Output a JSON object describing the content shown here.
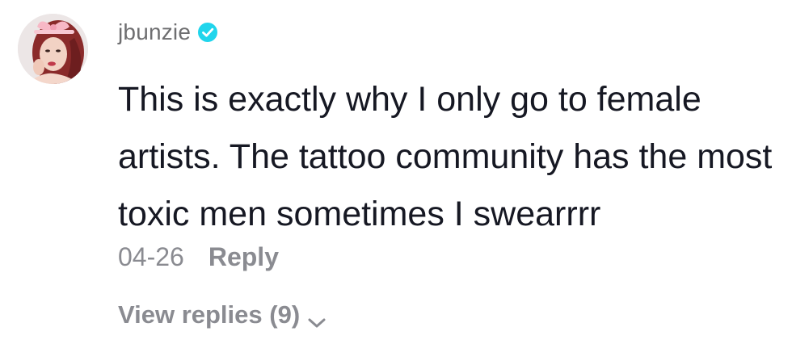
{
  "comment": {
    "username": "jbunzie",
    "verified": true,
    "text": "This is exactly why I only go to female artists. The tattoo community has the most toxic men sometimes I swearrrr",
    "date": "04-26",
    "reply_label": "Reply",
    "view_replies_label": "View replies (9)"
  },
  "colors": {
    "verified_badge": "#20D5EC",
    "text_primary": "#161823",
    "text_secondary": "#8A8B91"
  },
  "icons": {
    "verified": "verified-check-icon",
    "chevron": "chevron-down-icon"
  }
}
